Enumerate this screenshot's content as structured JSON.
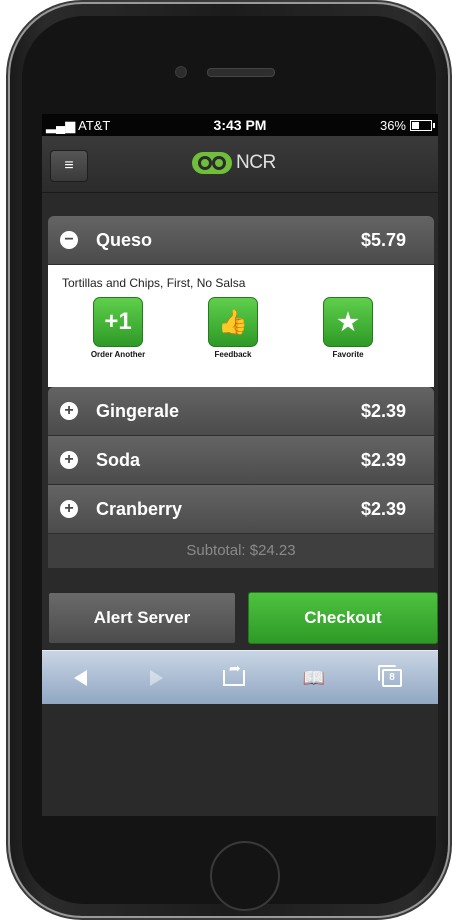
{
  "status_bar": {
    "carrier": "AT&T",
    "time": "3:43 PM",
    "battery": "36%"
  },
  "header": {
    "brand": "NCR"
  },
  "order": {
    "items": [
      {
        "name": "Queso",
        "price": "$5.79",
        "expanded": true,
        "toggle": "−"
      },
      {
        "name": "Gingerale",
        "price": "$2.39",
        "expanded": false,
        "toggle": "+"
      },
      {
        "name": "Soda",
        "price": "$2.39",
        "expanded": false,
        "toggle": "+"
      },
      {
        "name": "Cranberry",
        "price": "$2.39",
        "expanded": false,
        "toggle": "+"
      }
    ],
    "details": {
      "description": "Tortillas and Chips, First, No Salsa",
      "actions": [
        {
          "glyph": "+1",
          "label": "Order Another"
        },
        {
          "glyph": "👍",
          "label": "Feedback"
        },
        {
          "glyph": "★",
          "label": "Favorite"
        }
      ]
    },
    "subtotal": "Subtotal: $24.23"
  },
  "buttons": {
    "alert_label": "Alert Server",
    "checkout_label": "Checkout"
  },
  "browser_toolbar": {
    "tab_count": "8"
  },
  "colors": {
    "accent_green": "#3bad31",
    "browser_bar": "#a6b8d0"
  }
}
